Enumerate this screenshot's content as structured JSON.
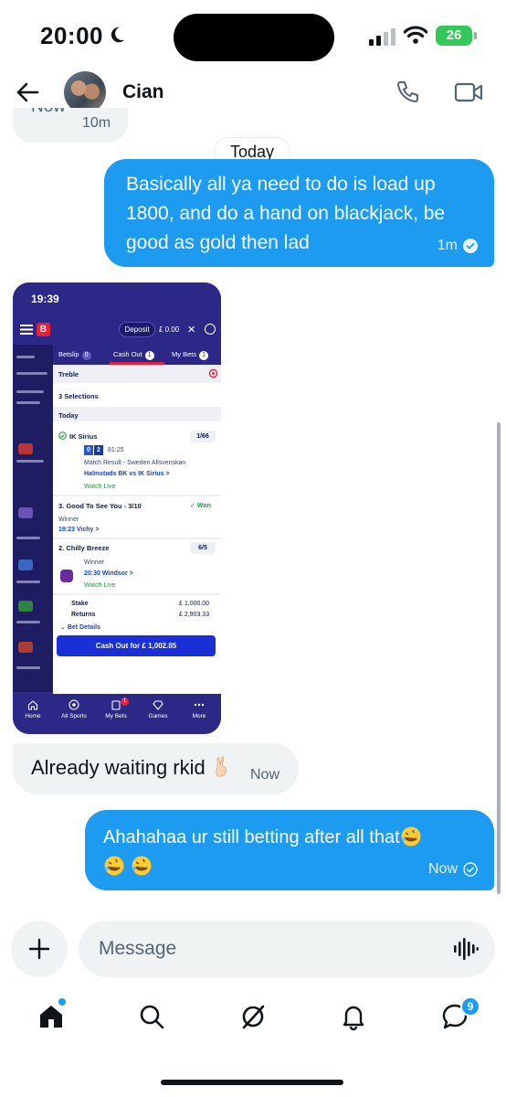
{
  "status_bar": {
    "time": "20:00",
    "battery": "26"
  },
  "header": {
    "contact_name": "Cian"
  },
  "chat": {
    "previous_clip": {
      "text": "Now",
      "time": "10m"
    },
    "date_separator": "Today",
    "messages": [
      {
        "direction": "outgoing",
        "text": "Basically all ya need to do is load up 1800, and do a hand on blackjack, be good as gold then lad",
        "time": "1m"
      },
      {
        "direction": "incoming",
        "text": "Already waiting rkid",
        "time": "Now"
      },
      {
        "direction": "outgoing",
        "text": "Ahahahaa ur still betting after all that",
        "time": "Now"
      }
    ]
  },
  "shared_screenshot": {
    "status_time": "19:39",
    "logo": "B",
    "deposit_label": "Deposit",
    "balance": "£ 0.00",
    "tabs": [
      {
        "label": "Betslip",
        "count": "0"
      },
      {
        "label": "Cash Out",
        "count": "1"
      },
      {
        "label": "My Bets",
        "count": "1"
      }
    ],
    "bet_type": "Treble",
    "selections_count": "3 Selections",
    "section": "Today",
    "legs": [
      {
        "title": "IK Sirius",
        "odds": "1/66",
        "score_home": "0",
        "score_away": "2",
        "clock": "81:25",
        "market": "Match Result - Sweden Allsvenskan",
        "event": "Halmstads BK vs IK Sirius >",
        "watch": "Watch Live"
      },
      {
        "title": "3. Good To See You - 3/10",
        "result": "✓ Won",
        "market": "Winner",
        "event": "19:23 Vichy >"
      },
      {
        "title": "2. Chilly Breeze",
        "odds": "6/5",
        "market": "Winner",
        "event": "20:30 Windsor >",
        "watch": "Watch Live"
      }
    ],
    "stake_label": "Stake",
    "stake_value": "£ 1,000.00",
    "returns_label": "Returns",
    "returns_value": "£ 2,903.33",
    "bet_details": "Bet Details",
    "cashout_button": "Cash Out for £ 1,002.85",
    "nav": [
      {
        "label": "Home",
        "icon": "home-icon"
      },
      {
        "label": "All Sports",
        "icon": "football-icon"
      },
      {
        "label": "My Bets",
        "icon": "betslip-icon",
        "badge": "1"
      },
      {
        "label": "Games",
        "icon": "diamond-icon"
      },
      {
        "label": "More",
        "icon": "more-icon"
      }
    ]
  },
  "composer": {
    "placeholder": "Message"
  },
  "bottom_nav": {
    "items": [
      "home-icon",
      "search-icon",
      "grok-icon",
      "notifications-icon",
      "messages-icon"
    ],
    "messages_badge": "9"
  },
  "colors": {
    "accent": "#1d9bf0",
    "incoming_bubble": "#eff3f4",
    "bet_brand": "#2b2887"
  }
}
